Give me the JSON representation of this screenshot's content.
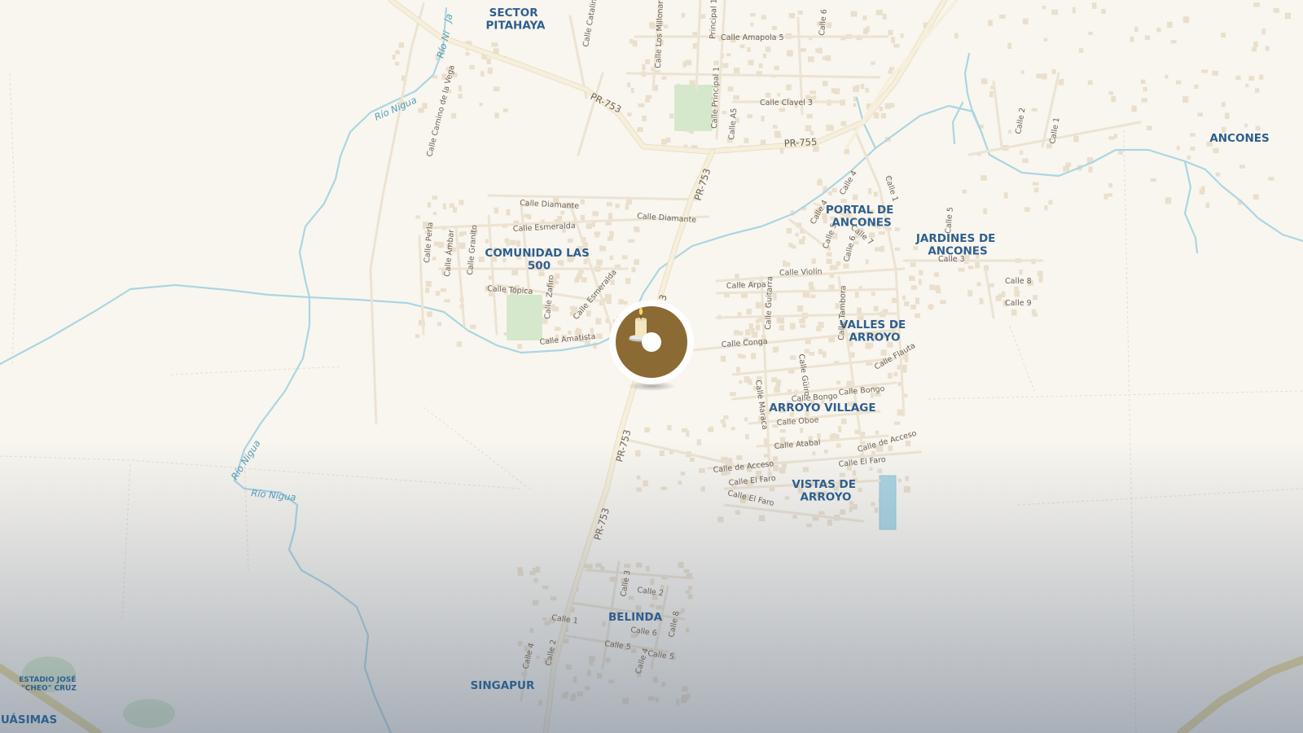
{
  "colors": {
    "background": "#f9f6ef",
    "water": "#aad6e3",
    "road_major": "#f4ebd2",
    "road_minor": "#efe6d6",
    "building": "#eadfcd",
    "park": "#d6e8cc",
    "place_label": "#2f5f8e",
    "street_label": "#6b6258",
    "marker_ring": "#ffffff",
    "marker_fill": "#8b6a34",
    "bottom_fade": "#5a6a82"
  },
  "marker": {
    "icon": "memorial-candle-icon",
    "name": "location-marker"
  },
  "places": {
    "sector_pitahaya": [
      "SECTOR",
      "PITAHAYA"
    ],
    "comunidad_las_500": [
      "COMUNIDAD LAS",
      "500"
    ],
    "portal_de_ancones": [
      "PORTAL DE",
      "ANCONES"
    ],
    "jardines_de_ancones": [
      "JARDINES DE",
      "ANCONES"
    ],
    "valles_de_arroyo": [
      "VALLES DE",
      "ARROYO"
    ],
    "arroyo_village": "ARROYO VILLAGE",
    "vistas_de_arroyo": [
      "VISTAS DE",
      "ARROYO"
    ],
    "ancones": "ANCONES",
    "belinda": "BELINDA",
    "singapur": "SINGAPUR",
    "guasimas": "GUÁSIMAS",
    "estadio": [
      "ESTADIO JOSÉ",
      "\"CHEO\" CRUZ"
    ]
  },
  "roads": {
    "pr753_a": "PR-753",
    "pr753_b": "PR-753",
    "pr753_c": "PR-753",
    "pr753_d": "PR-753",
    "pr753_partial": "3",
    "pr755": "PR-755"
  },
  "rivers": {
    "rio_nigua_1": "Río Nigua",
    "rio_nigua_2": "Río Nigua",
    "rio_nigua_3": "Río Nigua",
    "rio_ni_partial": "Río Ni",
    "ja_partial": "ja"
  },
  "streets": {
    "amapola5": "Calle Amapola 5",
    "clavel3": "Calle Clavel 3",
    "principal1": "Calle Principal 1",
    "principal1_top": "Principal 1",
    "los_millonarios": "Calle Los Millonarios",
    "catalina": "Calle Catalina",
    "calle6_top": "Calle 6",
    "a5": "Calle A5",
    "calle2_ancones": "Calle 2",
    "calle1_ancones": "Calle 1",
    "camino_vega": "Calle Camino de la Vega",
    "diamante1": "Calle Diamante",
    "diamante2": "Calle Diamante",
    "esmeralda1": "Calle Esmeralda",
    "esmeralda2": "Calle Esmeralda",
    "perla": "Calle Perla",
    "ambar": "Calle Ámbar",
    "granito": "Calle Granito",
    "topica": "Calle Tópica",
    "zafiro": "Calle Zafiro",
    "amatista": "Calle Amatista",
    "calle4_portal": "Calle 4",
    "calle1_portal": "Calle 1",
    "calle4b_portal": "Calle 4",
    "calle5_portal": "Calle 5",
    "calle6_portal": "Calle 6",
    "calle7_portal": "Calle 7",
    "calle5_jardines": "Calle 5",
    "calle3_jardines": "Calle 3",
    "calle8_jardines": "Calle 8",
    "calle9_jardines": "Calle 9",
    "violin": "Calle Violín",
    "arpa": "Calle Arpa",
    "guitarra": "Calle Guitarra",
    "tambora": "Calle Tambora",
    "conga": "Calle Conga",
    "flauta": "Calle Flauta",
    "guiro": "Calle Güiro",
    "maraca": "Calle Maraca",
    "bongo1": "Calle Bongo",
    "bongo2": "Calle Bongo",
    "oboe": "Calle Oboe",
    "atabal": "Calle Atabal",
    "acceso1": "Calle de Acceso",
    "acceso2": "Calle de Acceso",
    "faro1": "Calle El Faro",
    "faro2": "Calle El Faro",
    "faro3": "Calle El Faro",
    "b_calle3": "Calle 3",
    "b_calle2": "Calle 2",
    "b_calle1": "Calle 1",
    "b_calle6": "Calle 6",
    "b_calle8": "Calle 8",
    "b_calle5a": "Calle 5",
    "b_calle5b": "Calle 5",
    "b_calle4a": "Calle 4",
    "b_calle4b": "Calle 4",
    "b_calle2b": "Calle 2"
  }
}
